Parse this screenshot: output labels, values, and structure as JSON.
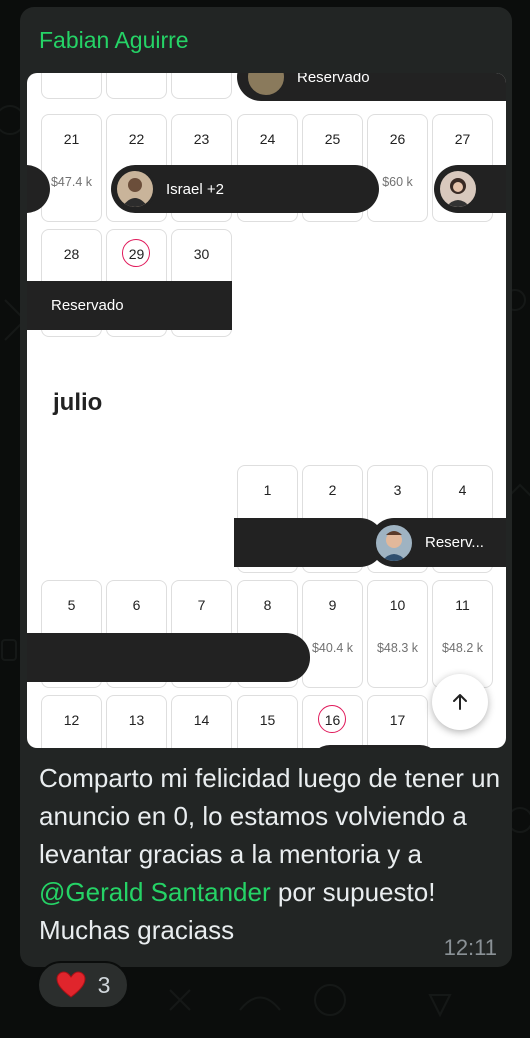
{
  "sender": "Fabian Aguirre",
  "screenshot": {
    "top_partial_label": "Reservado",
    "row1_days": [
      "21",
      "22",
      "23",
      "24",
      "25",
      "26",
      "27"
    ],
    "row1_prices": {
      "d21": "$47.4 k",
      "d26": "$60 k"
    },
    "pill_israel": "Israel +2",
    "row2_days": [
      "28",
      "29",
      "30"
    ],
    "pill_reservado": "Reservado",
    "month_label": "julio",
    "row3_days": [
      "1",
      "2",
      "3",
      "4"
    ],
    "pill_reserv": "Reserv...",
    "row4_days": [
      "5",
      "6",
      "7",
      "8",
      "9",
      "10",
      "11"
    ],
    "row4_prices": {
      "d9": "$40.4 k",
      "d10": "$48.3 k",
      "d11": "$48.2 k"
    },
    "row5_days": [
      "12",
      "13",
      "14",
      "15",
      "16",
      "17"
    ]
  },
  "message": {
    "text_before": "Comparto mi felicidad luego de tener un anuncio en 0, lo estamos volviendo a levantar gracias a la mentoria y a ",
    "mention": "@Gerald Santander",
    "text_after": " por supuesto! Muchas graciass",
    "time": "12:11"
  },
  "reaction": {
    "emoji": "heart-icon",
    "count": "3"
  },
  "colors": {
    "accent": "#25d366",
    "bubble": "#222524",
    "today_ring": "#e0195a"
  }
}
